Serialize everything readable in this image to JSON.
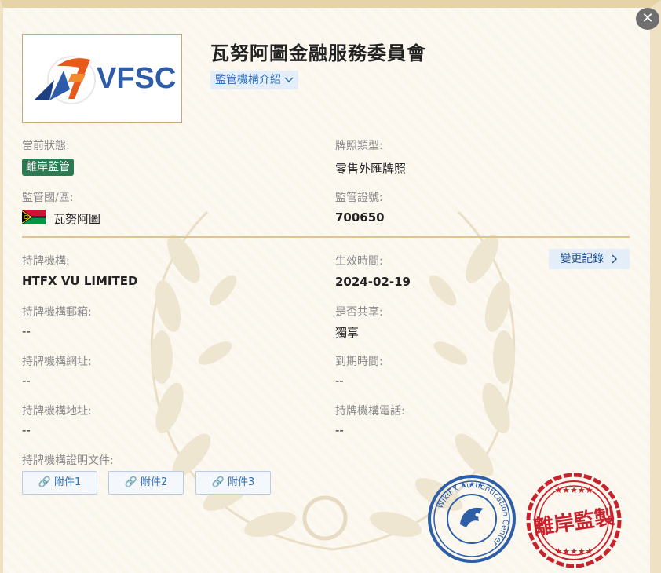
{
  "regulator": {
    "name": "瓦努阿圖金融服務委員會",
    "logo_text": "VFSC",
    "intro_button": "監管機構介紹"
  },
  "summary": {
    "status_label": "當前狀態:",
    "status_value": "離岸監管",
    "license_type_label": "牌照類型:",
    "license_type_value": "零售外匯牌照",
    "region_label": "監管國/區:",
    "region_value": "瓦努阿圖",
    "license_no_label": "監管證號:",
    "license_no_value": "700650"
  },
  "details": {
    "holder_label": "持牌機構:",
    "holder_value": "HTFX VU LIMITED",
    "effective_label": "生效時間:",
    "effective_value": "2024-02-19",
    "change_log_button": "變更記錄",
    "email_label": "持牌機構郵箱:",
    "email_value": "--",
    "shared_label": "是否共享:",
    "shared_value": "獨享",
    "website_label": "持牌機構網址:",
    "website_value": "--",
    "expiry_label": "到期時間:",
    "expiry_value": "--",
    "address_label": "持牌機構地址:",
    "address_value": "--",
    "phone_label": "持牌機構電話:",
    "phone_value": "--",
    "docs_label": "持牌機構證明文件:",
    "attachments": [
      "附件1",
      "附件2",
      "附件3"
    ]
  },
  "stamps": {
    "auth_text": "WikiFX Authentication Center",
    "offshore_text": "離岸監製"
  },
  "colors": {
    "badge_green": "#2c7a51",
    "accent_blue": "#2f6fb7",
    "stamp_red": "#c8232c",
    "stamp_blue": "#2d5ea6",
    "divider_gold": "#dcc593"
  },
  "icons": {
    "close": "close-icon",
    "chevron": "chevron-down-icon",
    "chevron_right": "chevron-right-icon",
    "link": "link-icon",
    "flag": "vanuatu-flag-icon"
  }
}
